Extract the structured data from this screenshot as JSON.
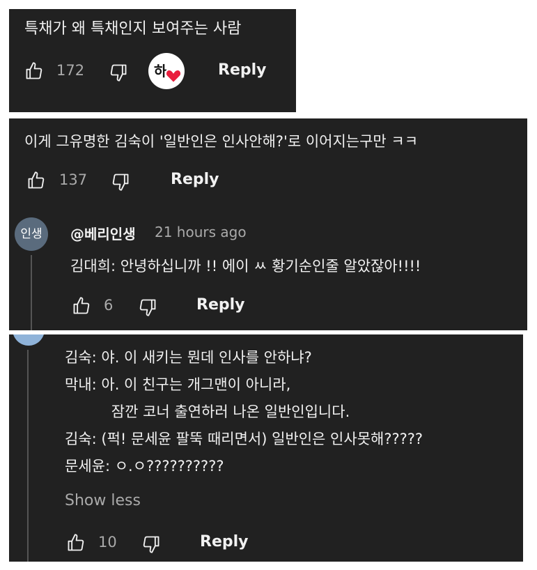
{
  "comment1": {
    "text": "특채가 왜 특채인지 보여주는 사람",
    "likes": "172",
    "creator_heart_avatar_letter": "하",
    "reply_label": "Reply"
  },
  "comment2": {
    "text": "이게 그유명한  김숙이  '일반인은 인사안해?'로 이어지는구만 ㅋㅋ",
    "likes": "137",
    "reply_label": "Reply"
  },
  "reply1": {
    "avatar_text": "인생",
    "author": "@베리인생",
    "time": "21 hours ago",
    "text": "김대희: 안녕하십니까 !! 에이 ㅆ 황기순인줄 알았잖아!!!!",
    "likes": "6",
    "reply_label": "Reply"
  },
  "reply2": {
    "lines": [
      "김숙: 야. 이 새키는 뭔데 인사를 안하냐?",
      "막내: 아. 이 친구는 개그맨이 아니라,",
      "          잠깐 코너 출연하러 나온 일반인입니다.",
      "김숙: (퍽! 문세윤 팔뚝 때리면서) 일반인은 인사못해?????",
      "문세윤: ㅇ.ㅇ??????????"
    ],
    "show_less_label": "Show less",
    "likes": "10",
    "reply_label": "Reply"
  },
  "colors": {
    "panel_bg": "#212121",
    "text": "#f1f1f1",
    "muted": "#aaaaaa",
    "heart": "#e91e3d",
    "avatar_bg": "#5a6b7d"
  }
}
